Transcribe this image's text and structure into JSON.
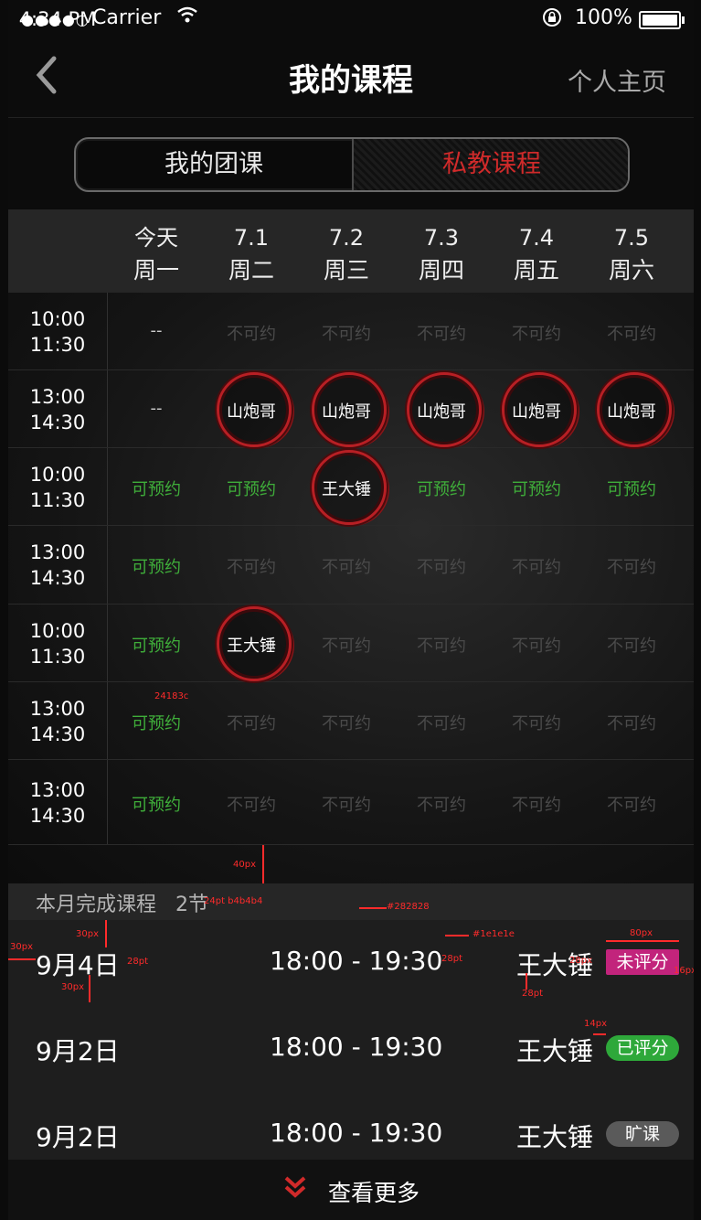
{
  "status": {
    "signal": "●●●●○",
    "carrier": "Carrier",
    "time": "4:34 PM",
    "battery": "100%"
  },
  "nav": {
    "back": "‹",
    "title": "我的课程",
    "right": "个人主页"
  },
  "tabs": [
    {
      "label": "我的团课",
      "active": false
    },
    {
      "label": "私教课程",
      "active": true
    }
  ],
  "days": [
    {
      "date": "今天",
      "weekday": "周一"
    },
    {
      "date": "7.1",
      "weekday": "周二"
    },
    {
      "date": "7.2",
      "weekday": "周三"
    },
    {
      "date": "7.3",
      "weekday": "周四"
    },
    {
      "date": "7.4",
      "weekday": "周五"
    },
    {
      "date": "7.5",
      "weekday": "周六"
    }
  ],
  "slots": [
    {
      "start": "10:00",
      "end": "11:30",
      "cells": [
        {
          "text": "--",
          "state": "dash"
        },
        {
          "text": "不可约",
          "state": "na"
        },
        {
          "text": "不可约",
          "state": "na"
        },
        {
          "text": "不可约",
          "state": "na"
        },
        {
          "text": "不可约",
          "state": "na"
        },
        {
          "text": "不可约",
          "state": "na"
        }
      ]
    },
    {
      "start": "13:00",
      "end": "14:30",
      "cells": [
        {
          "text": "--",
          "state": "dash"
        },
        {
          "text": "山炮哥",
          "state": "booked"
        },
        {
          "text": "山炮哥",
          "state": "booked"
        },
        {
          "text": "山炮哥",
          "state": "booked"
        },
        {
          "text": "山炮哥",
          "state": "booked"
        },
        {
          "text": "山炮哥",
          "state": "booked"
        }
      ]
    },
    {
      "start": "10:00",
      "end": "11:30",
      "cells": [
        {
          "text": "可预约",
          "state": "av"
        },
        {
          "text": "可预约",
          "state": "av"
        },
        {
          "text": "王大锤",
          "state": "booked"
        },
        {
          "text": "可预约",
          "state": "av"
        },
        {
          "text": "可预约",
          "state": "av"
        },
        {
          "text": "可预约",
          "state": "av"
        }
      ]
    },
    {
      "start": "13:00",
      "end": "14:30",
      "cells": [
        {
          "text": "可预约",
          "state": "av"
        },
        {
          "text": "不可约",
          "state": "na"
        },
        {
          "text": "不可约",
          "state": "na"
        },
        {
          "text": "不可约",
          "state": "na"
        },
        {
          "text": "不可约",
          "state": "na"
        },
        {
          "text": "不可约",
          "state": "na"
        }
      ]
    },
    {
      "start": "10:00",
      "end": "11:30",
      "cells": [
        {
          "text": "可预约",
          "state": "av"
        },
        {
          "text": "王大锤",
          "state": "booked"
        },
        {
          "text": "不可约",
          "state": "na"
        },
        {
          "text": "不可约",
          "state": "na"
        },
        {
          "text": "不可约",
          "state": "na"
        },
        {
          "text": "不可约",
          "state": "na"
        }
      ]
    },
    {
      "start": "13:00",
      "end": "14:30",
      "cells": [
        {
          "text": "可预约",
          "state": "av"
        },
        {
          "text": "不可约",
          "state": "na"
        },
        {
          "text": "不可约",
          "state": "na"
        },
        {
          "text": "不可约",
          "state": "na"
        },
        {
          "text": "不可约",
          "state": "na"
        },
        {
          "text": "不可约",
          "state": "na"
        }
      ]
    },
    {
      "start": "13:00",
      "end": "14:30",
      "cells": [
        {
          "text": "可预约",
          "state": "av"
        },
        {
          "text": "不可约",
          "state": "na"
        },
        {
          "text": "不可约",
          "state": "na"
        },
        {
          "text": "不可约",
          "state": "na"
        },
        {
          "text": "不可约",
          "state": "na"
        },
        {
          "text": "不可约",
          "state": "na"
        }
      ]
    }
  ],
  "summary": {
    "label": "本月完成课程",
    "count": "2节"
  },
  "records": [
    {
      "date": "9月4日",
      "time": "18:00 - 19:30",
      "coach": "王大锤",
      "badge": "未评分",
      "badge_style": "pink"
    },
    {
      "date": "9月2日",
      "time": "18:00 - 19:30",
      "coach": "王大锤",
      "badge": "已评分",
      "badge_style": "green"
    },
    {
      "date": "9月2日",
      "time": "18:00 - 19:30",
      "coach": "王大锤",
      "badge": "旷课",
      "badge_style": "gray"
    }
  ],
  "more": {
    "label": "查看更多"
  },
  "annotations": {
    "a1": "24183c",
    "a2": "40px",
    "a3": "24pt b4b4b4",
    "a4": "#282828",
    "a5": "30px",
    "a6": "30px",
    "a7": "28pt",
    "a8": "30px",
    "a9": "#1e1e1e",
    "a10": "28pt",
    "a11": "80px",
    "a12": "28px",
    "a13": "16px",
    "a14": "28pt",
    "a15": "14px"
  },
  "colors": {
    "accent_red": "#d02a2a",
    "available_green": "#3fae3a",
    "pink_badge": "#c2247c",
    "green_badge": "#2ea83a",
    "gray_badge": "#5a5a5a"
  }
}
